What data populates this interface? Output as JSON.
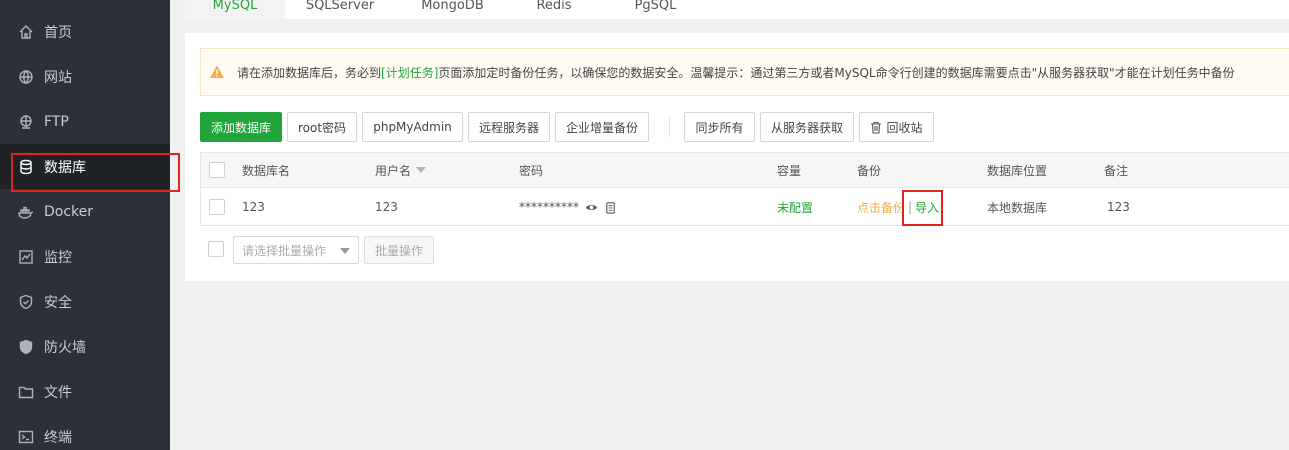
{
  "sidebar": {
    "items": [
      {
        "label": "首页",
        "icon": "home-icon"
      },
      {
        "label": "网站",
        "icon": "globe-icon"
      },
      {
        "label": "FTP",
        "icon": "ftp-icon"
      },
      {
        "label": "数据库",
        "icon": "database-icon"
      },
      {
        "label": "Docker",
        "icon": "docker-icon"
      },
      {
        "label": "监控",
        "icon": "monitor-icon"
      },
      {
        "label": "安全",
        "icon": "shield-icon"
      },
      {
        "label": "防火墙",
        "icon": "firewall-icon"
      },
      {
        "label": "文件",
        "icon": "folder-icon"
      },
      {
        "label": "终端",
        "icon": "terminal-icon"
      }
    ],
    "active_index": 3
  },
  "tabs": [
    {
      "label": "MySQL"
    },
    {
      "label": "SQLServer"
    },
    {
      "label": "MongoDB"
    },
    {
      "label": "Redis"
    },
    {
      "label": "PgSQL"
    }
  ],
  "alert": {
    "before": "请在添加数据库后，务必到",
    "link": "[计划任务]",
    "after": "页面添加定时备份任务，以确保您的数据安全。温馨提示：通过第三方或者MySQL命令行创建的数据库需要点击\"从服务器获取\"才能在计划任务中备份"
  },
  "toolbar": {
    "add_db": "添加数据库",
    "root_pwd": "root密码",
    "phpmyadmin": "phpMyAdmin",
    "remote_server": "远程服务器",
    "incremental_backup": "企业增量备份",
    "sync_all": "同步所有",
    "fetch_from_server": "从服务器获取",
    "recycle_bin": "回收站"
  },
  "table": {
    "headers": {
      "name": "数据库名",
      "user": "用户名",
      "password": "密码",
      "capacity": "容量",
      "backup": "备份",
      "location": "数据库位置",
      "note": "备注"
    },
    "rows": [
      {
        "name": "123",
        "user": "123",
        "password": "**********",
        "capacity": "未配置",
        "backup": "点击备份",
        "separator": "|",
        "import": "导入",
        "location": "本地数据库",
        "note": "123"
      }
    ]
  },
  "batch": {
    "select_placeholder": "请选择批量操作",
    "action": "批量操作"
  },
  "colors": {
    "accent": "#20a53a",
    "sidebar_bg": "#2c3138",
    "warning": "#f0ad4e",
    "highlight": "#e0251f"
  }
}
